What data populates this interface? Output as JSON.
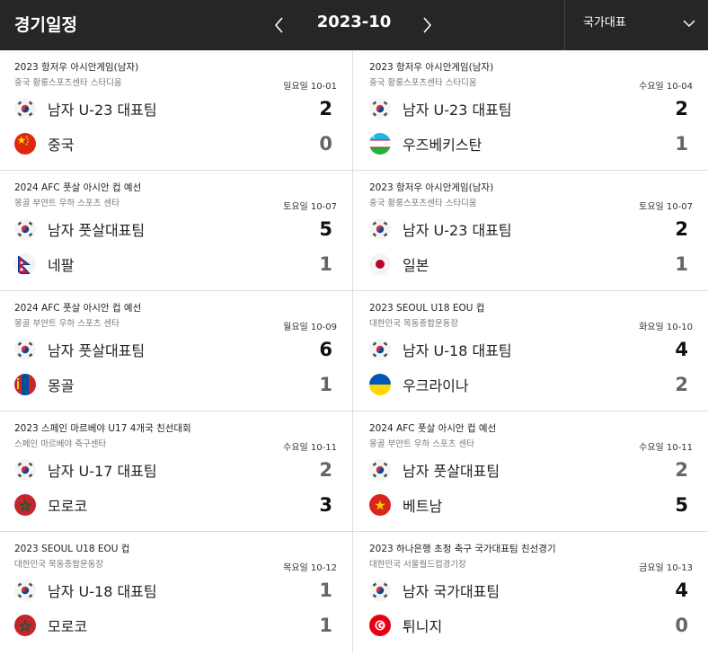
{
  "header": {
    "title": "경기일정",
    "month": "2023-10",
    "filter": "국가대표"
  },
  "matches": [
    {
      "competition": "2023 항저우 아시안게임(남자)",
      "venue": "중국 황룽스포츠센타 스타디움",
      "date": "일요일 10-01",
      "home": {
        "name": "남자 U-23 대표팀",
        "flag": "korea-flag-icon",
        "score": "2"
      },
      "away": {
        "name": "중국",
        "flag": "china-flag-icon",
        "score": "0"
      }
    },
    {
      "competition": "2023 항저우 아시안게임(남자)",
      "venue": "중국 황룽스포츠센타 스타디움",
      "date": "수요일 10-04",
      "home": {
        "name": "남자 U-23 대표팀",
        "flag": "korea-flag-icon",
        "score": "2"
      },
      "away": {
        "name": "우즈베키스탄",
        "flag": "uzbekistan-flag-icon",
        "score": "1"
      }
    },
    {
      "competition": "2024 AFC 풋살 아시안 컵 예선",
      "venue": "몽골 부얀트 우하 스포츠 센타",
      "date": "토요일 10-07",
      "home": {
        "name": "남자 풋살대표팀",
        "flag": "korea-flag-icon",
        "score": "5"
      },
      "away": {
        "name": "네팔",
        "flag": "nepal-flag-icon",
        "score": "1"
      }
    },
    {
      "competition": "2023 항저우 아시안게임(남자)",
      "venue": "중국 황룽스포츠센타 스타디움",
      "date": "토요일 10-07",
      "home": {
        "name": "남자 U-23 대표팀",
        "flag": "korea-flag-icon",
        "score": "2"
      },
      "away": {
        "name": "일본",
        "flag": "japan-flag-icon",
        "score": "1"
      }
    },
    {
      "competition": "2024 AFC 풋살 아시안 컵 예선",
      "venue": "몽골 부얀트 우하 스포츠 센타",
      "date": "월요일 10-09",
      "home": {
        "name": "남자 풋살대표팀",
        "flag": "korea-flag-icon",
        "score": "6"
      },
      "away": {
        "name": "몽골",
        "flag": "mongolia-flag-icon",
        "score": "1"
      }
    },
    {
      "competition": "2023 SEOUL U18 EOU 컵",
      "venue": "대한민국 목동종합운동장",
      "date": "화요일 10-10",
      "home": {
        "name": "남자 U-18 대표팀",
        "flag": "korea-flag-icon",
        "score": "4"
      },
      "away": {
        "name": "우크라이나",
        "flag": "ukraine-flag-icon",
        "score": "2"
      }
    },
    {
      "competition": "2023 스페인 마르베야 U17 4개국 친선대회",
      "venue": "스페인 마르베야 축구센타",
      "date": "수요일 10-11",
      "home": {
        "name": "남자 U-17 대표팀",
        "flag": "korea-flag-icon",
        "score": "2"
      },
      "away": {
        "name": "모로코",
        "flag": "morocco-flag-icon",
        "score": "3"
      }
    },
    {
      "competition": "2024 AFC 풋살 아시안 컵 예선",
      "venue": "몽골 부얀트 우하 스포츠 센타",
      "date": "수요일 10-11",
      "home": {
        "name": "남자 풋살대표팀",
        "flag": "korea-flag-icon",
        "score": "2"
      },
      "away": {
        "name": "베트남",
        "flag": "vietnam-flag-icon",
        "score": "5"
      }
    },
    {
      "competition": "2023 SEOUL U18 EOU 컵",
      "venue": "대한민국 목동종합운동장",
      "date": "목요일 10-12",
      "home": {
        "name": "남자 U-18 대표팀",
        "flag": "korea-flag-icon",
        "score": "1"
      },
      "away": {
        "name": "모로코",
        "flag": "morocco-flag-icon",
        "score": "1"
      }
    },
    {
      "competition": "2023 하나은행 초청 축구 국가대표팀 친선경기",
      "venue": "대한민국 서울월드컵경기장",
      "date": "금요일 10-13",
      "home": {
        "name": "남자 국가대표팀",
        "flag": "korea-flag-icon",
        "score": "4"
      },
      "away": {
        "name": "튀니지",
        "flag": "tunisia-flag-icon",
        "score": "0"
      }
    }
  ]
}
